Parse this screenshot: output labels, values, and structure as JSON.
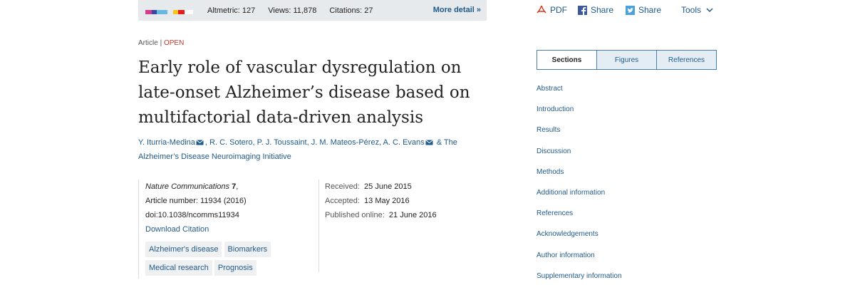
{
  "metrics": {
    "altmetric": "Altmetric: 127",
    "views": "Views: 11,878",
    "citations": "Citations: 27",
    "more": "More detail",
    "donut_colors": [
      "#d43d8a",
      "#3b46a6",
      "#65b9e1",
      "#e6eaed",
      "#f7c51c",
      "#e5201b",
      "#ffffff"
    ]
  },
  "tools": {
    "pdf": "PDF",
    "share_fb": "Share",
    "share_tw": "Share",
    "tools": "Tools"
  },
  "article": {
    "type": "Article",
    "separator": "|",
    "access": "OPEN",
    "title": "Early role of vascular dysregulation on late-onset Alzheimer’s disease based on multifactorial data-driven analysis",
    "authors": [
      {
        "name": "Y. Iturria-Medina",
        "email": true
      },
      {
        "name": "R. C. Sotero",
        "email": false
      },
      {
        "name": "P. J. Toussaint",
        "email": false
      },
      {
        "name": "J. M. Mateos-Pérez",
        "email": false
      },
      {
        "name": "A. C. Evans",
        "email": true
      }
    ],
    "group": "& The Alzheimer’s Disease Neuroimaging Initiative"
  },
  "meta": {
    "journal": "Nature Communications",
    "volume": "7",
    "article_number": "Article number: 11934 (2016)",
    "doi": "doi:10.1038/ncomms11934",
    "download": "Download Citation",
    "subjects": [
      "Alzheimer's disease",
      "Biomarkers",
      "Medical research",
      "Prognosis"
    ],
    "received_label": "Received:",
    "received": "25 June 2015",
    "accepted_label": "Accepted:",
    "accepted": "13 May 2016",
    "published_label": "Published online:",
    "published": "21 June 2016"
  },
  "sidebar": {
    "tabs": [
      "Sections",
      "Figures",
      "References"
    ],
    "sections": [
      "Abstract",
      "Introduction",
      "Results",
      "Discussion",
      "Methods",
      "Additional information",
      "References",
      "Acknowledgements",
      "Author information",
      "Supplementary information"
    ]
  },
  "colors": {
    "link": "#1f5a8a",
    "open": "#c0392b",
    "metrics_bg": "#e6eaed"
  }
}
